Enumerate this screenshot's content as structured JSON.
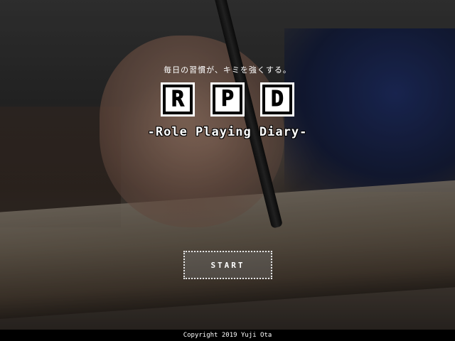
{
  "title_screen": {
    "tagline": "毎日の習慣が、キミを強くする。",
    "logo_letters": [
      "R",
      "P",
      "D"
    ],
    "subtitle": "-Role Playing Diary-",
    "start_label": "START"
  },
  "footer": {
    "copyright": "Copyright 2019 Yuji Ota"
  },
  "background": {
    "description_icon": "hand-writing-in-book-photo"
  },
  "colors": {
    "text": "#ffffff",
    "logo_tile": "#ffffff",
    "logo_border": "#000000",
    "footer_bg": "#000000"
  }
}
